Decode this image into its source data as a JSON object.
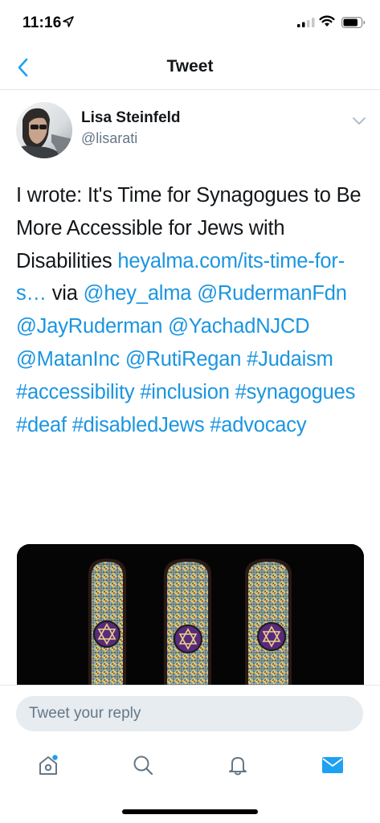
{
  "status_bar": {
    "time": "11:16"
  },
  "nav": {
    "title": "Tweet"
  },
  "tweet": {
    "author_name": "Lisa Steinfeld",
    "author_handle": "@lisarati",
    "text_prefix": "I wrote: It's Time for Synagogues to Be More Accessible for Jews with Disabilities ",
    "link": "heyalma.com/its-time-for-s…",
    "via": " via ",
    "mentions": [
      "@hey_alma",
      "@RudermanFdn",
      "@JayRuderman",
      "@YachadNJCD",
      "@MatanInc",
      "@RutiRegan"
    ],
    "hashtags": [
      "#Judaism",
      "#accessibility",
      "#inclusion",
      "#synagogues",
      "#deaf",
      "#disabledJews",
      "#advocacy"
    ]
  },
  "reply": {
    "placeholder": "Tweet your reply"
  },
  "colors": {
    "link": "#1b95e0",
    "text": "#14171a",
    "secondary": "#657786",
    "active_tab": "#1da1f2"
  },
  "icons": {
    "back": "chevron-left-icon",
    "caret": "chevron-down-icon",
    "home": "home-icon",
    "search": "search-icon",
    "notifications": "bell-icon",
    "messages": "mail-icon"
  }
}
